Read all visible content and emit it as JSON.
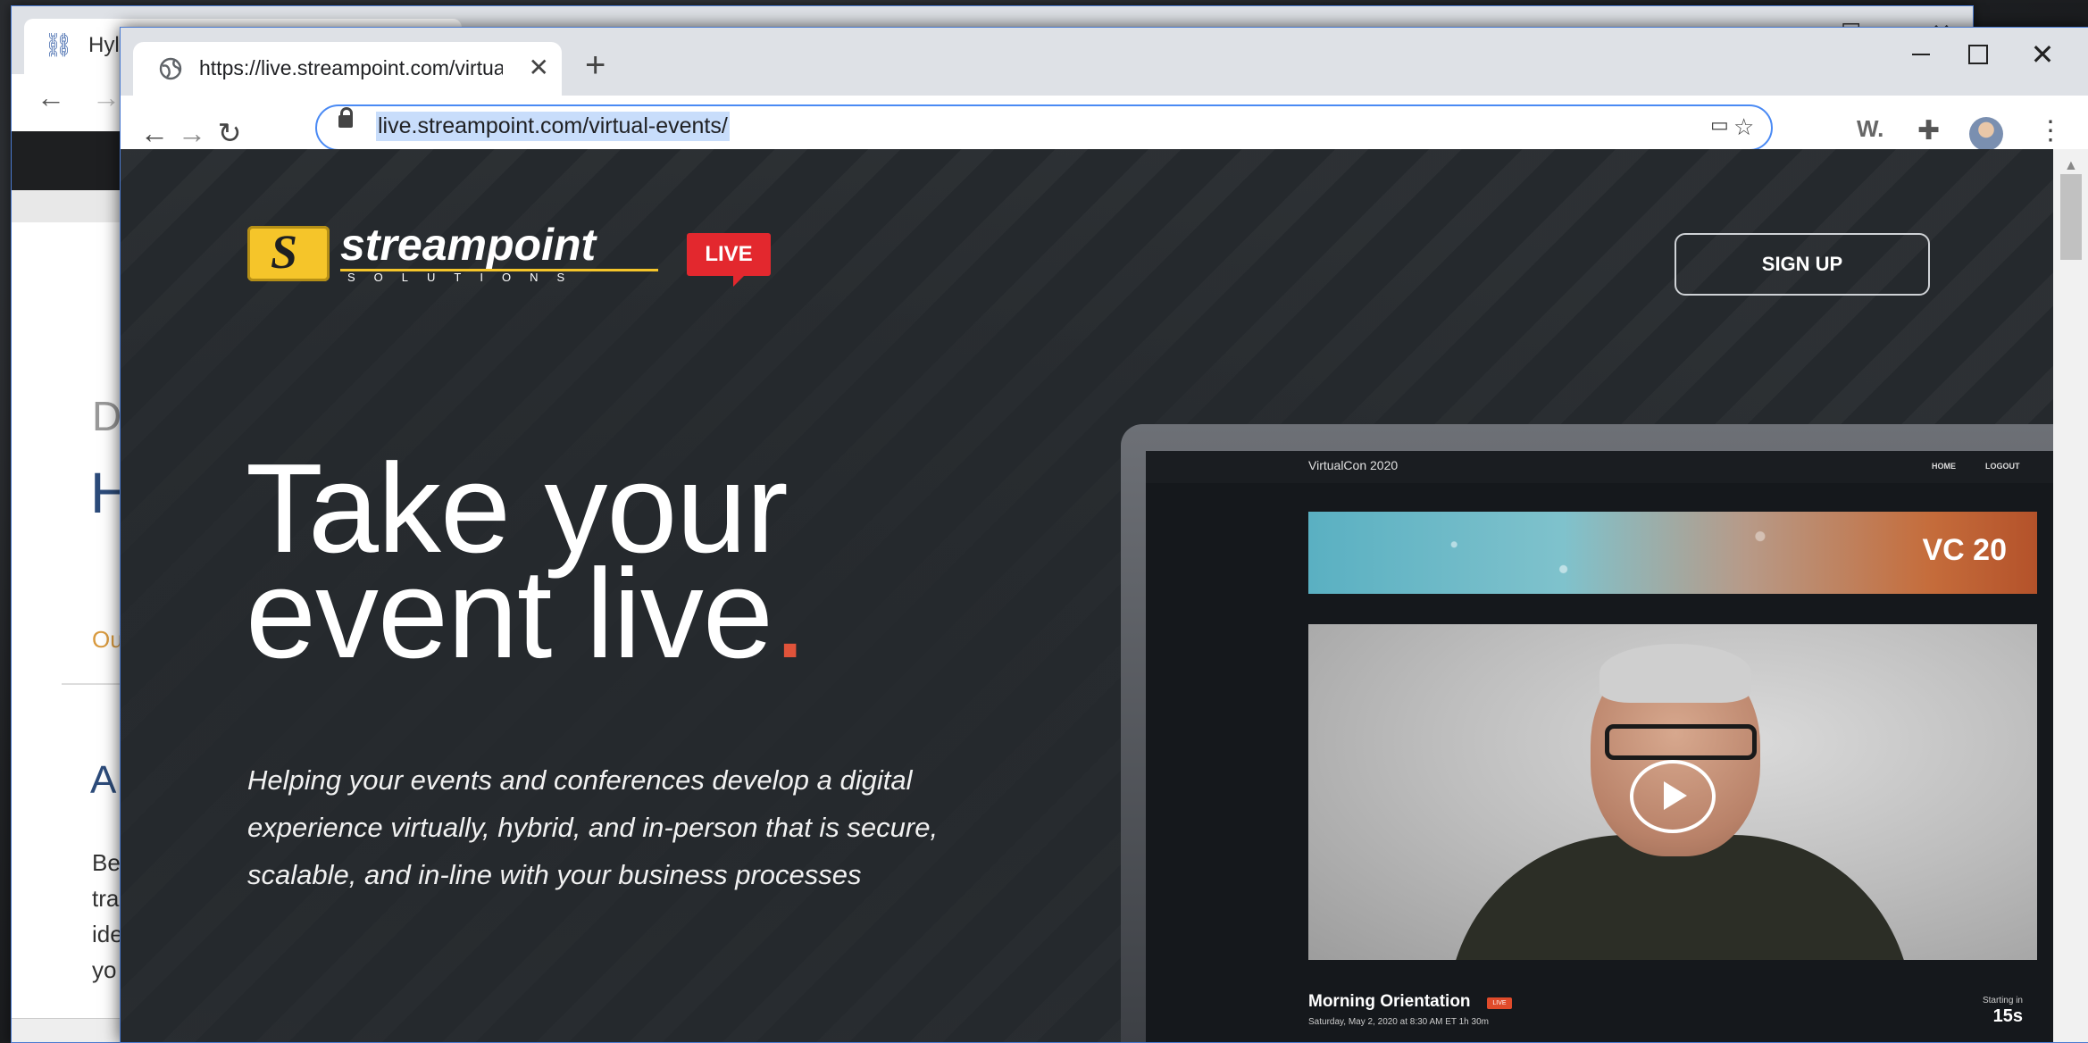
{
  "background_window": {
    "tab_title": "Hyl",
    "peek_heading_1": "D",
    "peek_heading_2": "H",
    "peek_link": "Ou",
    "peek_heading_3": "A",
    "peek_body": [
      "Be",
      "tra",
      "ide",
      "yo"
    ]
  },
  "browser": {
    "tab": {
      "title": "https://live.streampoint.com/virtual-events/",
      "close": "✕"
    },
    "new_tab": "+",
    "window_controls": {
      "close": "✕"
    },
    "url": "live.streampoint.com/virtual-events/",
    "extension_w": "W."
  },
  "page": {
    "logo": {
      "word": "streampoint",
      "sub": "SOLUTIONS"
    },
    "live_badge": "LIVE",
    "signup": "SIGN UP",
    "hero_line1": "Take your",
    "hero_line2": "event live",
    "hero_dot": ".",
    "subtitle": "Helping your events and conferences develop a digital experience virtually, hybrid, and in-person that is secure, scalable, and in-line with your business processes",
    "laptop": {
      "app_title": "VirtualCon 2020",
      "nav_home": "HOME",
      "nav_logout": "LOGOUT",
      "banner_text": "VC 20",
      "session_title": "Morning Orientation",
      "session_badge": "LIVE",
      "session_date": "Saturday, May 2, 2020 at 8:30 AM ET 1h 30m",
      "starting_label": "Starting in",
      "starting_time": "15s"
    }
  },
  "colors": {
    "accent_red": "#e3282e",
    "logo_yellow": "#f5c52a",
    "hero_dot": "#e0533a",
    "page_bg": "#25292d"
  }
}
